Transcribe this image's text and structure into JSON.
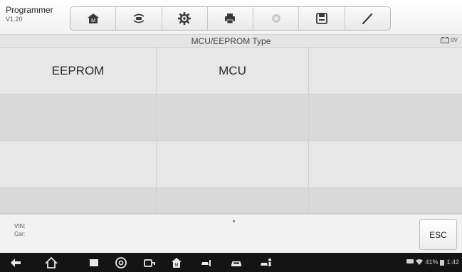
{
  "app": {
    "name": "Programmer",
    "version": "V1.20"
  },
  "toolbar": {
    "buttons": [
      {
        "icon": "home-icon"
      },
      {
        "icon": "vehicle-swap-icon"
      },
      {
        "icon": "gear-icon"
      },
      {
        "icon": "printer-icon"
      },
      {
        "icon": "help-icon"
      },
      {
        "icon": "save-icon"
      },
      {
        "icon": "pen-icon"
      }
    ]
  },
  "title": {
    "text": "MCU/EEPROM Type",
    "battery_icon": "battery-icon",
    "voltage": "0V"
  },
  "grid": {
    "cells": [
      "EEPROM",
      "MCU",
      "",
      "",
      "",
      "",
      "",
      "",
      "",
      "",
      "",
      ""
    ]
  },
  "footer": {
    "vin_label": "VIN:",
    "car_label": "Car:",
    "esc_label": "ESC"
  },
  "navbar": {
    "icons": [
      "back-icon",
      "home-icon",
      "recents-icon",
      "chrome-icon",
      "vci-icon",
      "maxisys-icon",
      "car-service-icon",
      "car-icon",
      "car-person-icon"
    ],
    "status": {
      "battery": "41%",
      "time": "1:42"
    }
  }
}
